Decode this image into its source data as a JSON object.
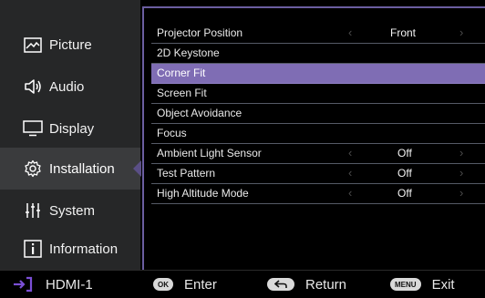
{
  "sidebar": {
    "items": [
      {
        "label": "Picture",
        "icon": "picture-icon"
      },
      {
        "label": "Audio",
        "icon": "speaker-icon"
      },
      {
        "label": "Display",
        "icon": "monitor-icon"
      },
      {
        "label": "Installation",
        "icon": "gear-icon",
        "active": true
      },
      {
        "label": "System",
        "icon": "sliders-icon"
      },
      {
        "label": "Information",
        "icon": "info-icon"
      }
    ]
  },
  "menu": {
    "rows": [
      {
        "name": "Projector Position",
        "value": "Front"
      },
      {
        "name": "2D Keystone"
      },
      {
        "name": "Corner Fit",
        "selected": true
      },
      {
        "name": "Screen Fit"
      },
      {
        "name": "Object Avoidance"
      },
      {
        "name": "Focus"
      },
      {
        "name": "Ambient Light Sensor",
        "value": "Off"
      },
      {
        "name": "Test Pattern",
        "value": "Off"
      },
      {
        "name": "High Altitude Mode",
        "value": "Off"
      }
    ]
  },
  "footer": {
    "source": "HDMI-1",
    "ok_key": "OK",
    "ok_label": "Enter",
    "return_label": "Return",
    "menu_key": "MENU",
    "exit_label": "Exit"
  },
  "colors": {
    "accent": "#7f6db4",
    "divider": "#6b5ea0",
    "sidebar_bg": "#262728",
    "input_arrow": "#7b4fd6"
  }
}
